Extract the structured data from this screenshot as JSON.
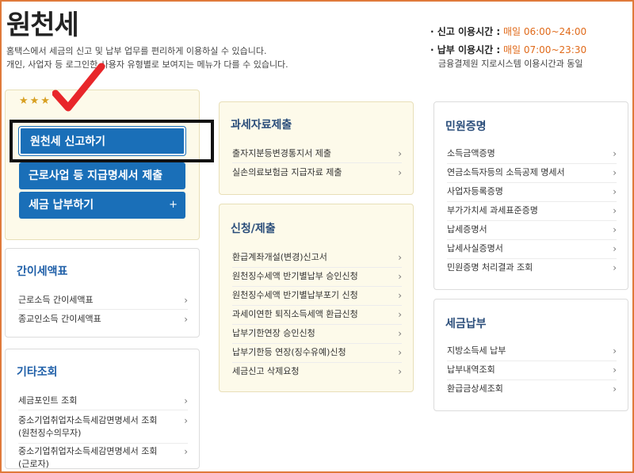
{
  "page": {
    "title": "원천세",
    "desc_line1": "홈택스에서 세금의 신고 및 납부 업무를 편리하게 이용하실 수 있습니다.",
    "desc_line2": "개인, 사업자 등 로그인한 사용자 유형별로 보여지는 메뉴가 다를 수 있습니다."
  },
  "hours": {
    "report_label": "· 신고 이용시간 :",
    "report_time": "매일 06:00~24:00",
    "pay_label": "· 납부 이용시간 :",
    "pay_time": "매일 07:00~23:30",
    "pay_note": "금융결제원 지로시스템 이용시간과 동일"
  },
  "quick": {
    "stars": "★★★",
    "btn1": "원천세 신고하기",
    "btn2": "근로사업 등 지급명세서 제출",
    "btn3": "세금 납부하기",
    "btn3_icon": "+"
  },
  "simple_table": {
    "title": "간이세액표",
    "items": [
      "근로소득 간이세액표",
      "종교인소득 간이세액표"
    ]
  },
  "other": {
    "title": "기타조회",
    "items": [
      "세금포인트 조회",
      "중소기업취업자소득세감면명세서 조회\n(원천징수의무자)",
      "중소기업취업자소득세감면명세서 조회\n(근로자)"
    ]
  },
  "submit": {
    "title": "과세자료제출",
    "items": [
      "출자지분등변경통지서 제출",
      "실손의료보험금 지급자료 제출"
    ]
  },
  "apply": {
    "title": "신청/제출",
    "items": [
      "환급계좌개설(변경)신고서",
      "원천징수세액 반기별납부 승인신청",
      "원천징수세액 반기별납부포기 신청",
      "과세이연한 퇴직소득세액 환급신청",
      "납부기한연장 승인신청",
      "납부기한등 연장(징수유예)신청",
      "세금신고 삭제요청"
    ]
  },
  "civil": {
    "title": "민원증명",
    "items": [
      "소득금액증명",
      "연금소득자등의 소득공제 명세서",
      "사업자등록증명",
      "부가가치세 과세표준증명",
      "납세증명서",
      "납세사실증명서",
      "민원증명 처리결과 조회"
    ]
  },
  "pay": {
    "title": "세금납부",
    "items": [
      "지방소득세 납부",
      "납부내역조회",
      "환급금상세조회"
    ]
  },
  "chev": "›"
}
